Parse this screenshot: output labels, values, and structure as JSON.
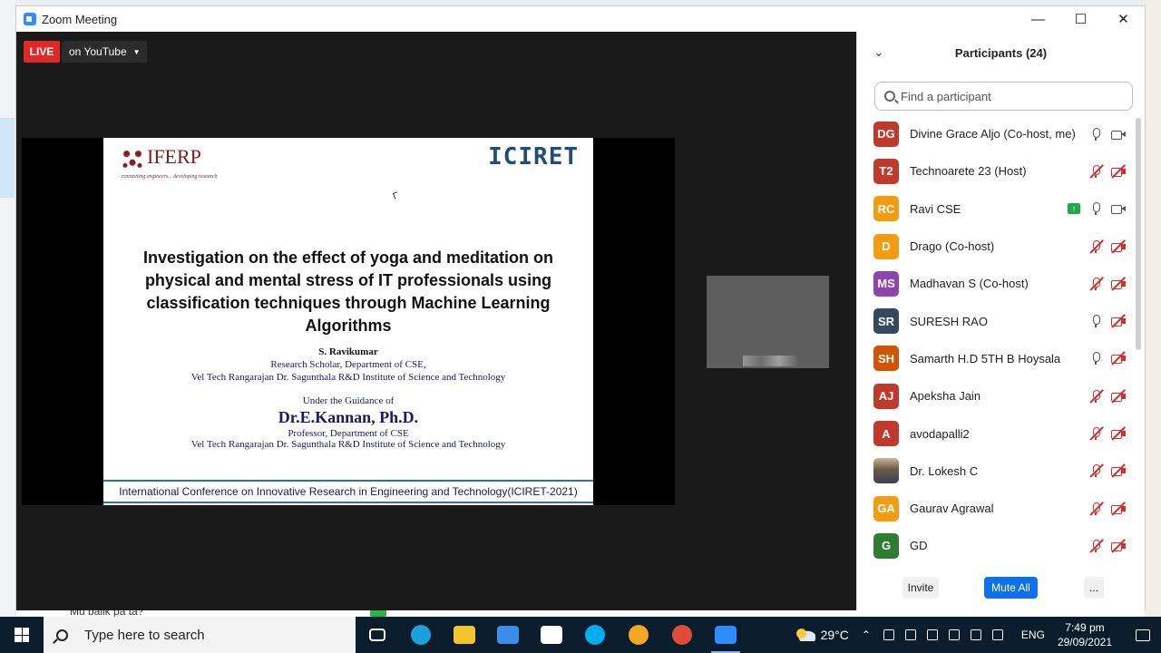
{
  "window": {
    "title": "Zoom Meeting"
  },
  "background": {
    "chat_text": "Mu balik pa ta?"
  },
  "live": {
    "badge": "LIVE",
    "destination": "on YouTube"
  },
  "slide": {
    "logo_left": "IFERP",
    "logo_left_tagline": "connecting engineers... developing research",
    "logo_right": "ICIRET",
    "title": "Investigation on the effect of yoga and meditation on physical and mental stress of IT professionals using classification techniques through Machine Learning Algorithms",
    "author_name": "S. Ravikumar",
    "author_role": "Research Scholar, Department of CSE,",
    "author_institute": "Vel Tech Rangarajan Dr. Sagunthala R&D Institute of Science and Technology",
    "guidance_label": "Under the Guidance of",
    "guide_name": "Dr.E.Kannan, Ph.D.",
    "guide_role": "Professor, Department of CSE",
    "guide_institute": "Vel Tech Rangarajan Dr. Sagunthala R&D Institute of Science and Technology",
    "conference": "International Conference on Innovative Research in Engineering and Technology(ICIRET-2021)"
  },
  "participants": {
    "title": "Participants (24)",
    "search_placeholder": "Find a participant",
    "list": [
      {
        "initials": "DG",
        "name": "Divine Grace Aljo (Co-host, me)",
        "color": "#c0392b",
        "mic": "on",
        "cam": "on",
        "sharing": false
      },
      {
        "initials": "T2",
        "name": "Technoarete 23 (Host)",
        "color": "#c0392b",
        "mic": "off",
        "cam": "off",
        "sharing": false
      },
      {
        "initials": "RC",
        "name": "Ravi CSE",
        "color": "#f39c12",
        "mic": "on",
        "cam": "on",
        "sharing": true
      },
      {
        "initials": "D",
        "name": "Drago (Co-host)",
        "color": "#f39c12",
        "mic": "off",
        "cam": "off",
        "sharing": false
      },
      {
        "initials": "MS",
        "name": "Madhavan S (Co-host)",
        "color": "#8e44ad",
        "mic": "off",
        "cam": "off",
        "sharing": false
      },
      {
        "initials": "SR",
        "name": "SURESH RAO",
        "color": "#34495e",
        "mic": "on",
        "cam": "off",
        "sharing": false
      },
      {
        "initials": "SH",
        "name": "Samarth H.D 5TH B Hoysala",
        "color": "#d35400",
        "mic": "on",
        "cam": "off",
        "sharing": false
      },
      {
        "initials": "AJ",
        "name": "Apeksha Jain",
        "color": "#c0392b",
        "mic": "off",
        "cam": "off",
        "sharing": false
      },
      {
        "initials": "A",
        "name": "avodapalli2",
        "color": "#c0392b",
        "mic": "off",
        "cam": "off",
        "sharing": false
      },
      {
        "initials": "",
        "name": "Dr. Lokesh C",
        "color": "photo",
        "mic": "off",
        "cam": "off",
        "sharing": false
      },
      {
        "initials": "GA",
        "name": "Gaurav Agrawal",
        "color": "#f39c12",
        "mic": "off",
        "cam": "off",
        "sharing": false
      },
      {
        "initials": "G",
        "name": "GD",
        "color": "#2e7d32",
        "mic": "off",
        "cam": "off",
        "sharing": false
      }
    ],
    "invite_label": "Invite",
    "mute_all_label": "Mute All",
    "more_label": "..."
  },
  "taskbar": {
    "search_placeholder": "Type here to search",
    "temperature": "29°C",
    "language": "ENG",
    "time": "7:49 pm",
    "date": "29/09/2021",
    "apps": [
      {
        "name": "task-view",
        "color": "#ffffff"
      },
      {
        "name": "edge",
        "color": "#1aa0db"
      },
      {
        "name": "file-explorer",
        "color": "#f4c430"
      },
      {
        "name": "mail",
        "color": "#3b8ee8"
      },
      {
        "name": "dropbox",
        "color": "#ffffff"
      },
      {
        "name": "skype",
        "color": "#00aff0"
      },
      {
        "name": "brave",
        "color": "#f5a623"
      },
      {
        "name": "chrome",
        "color": "#dd4b39"
      },
      {
        "name": "zoom",
        "color": "#2d8cff"
      }
    ]
  }
}
